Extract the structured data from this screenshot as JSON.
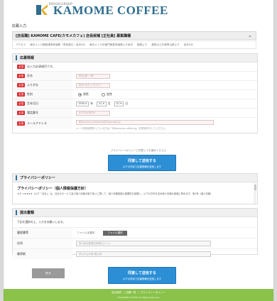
{
  "header": {
    "brand_small": "ROUGH GROUP",
    "brand": "KAMOME COFFEE"
  },
  "section_label": "応募入力",
  "job": {
    "title": "[店長職] KAMOME CAFE(カモメカフェ) 店長候補 [正社員] 募集職種",
    "sub_items": [
      "アクセス",
      "東京メトロ銀座線表参道駅「表参道口」徒歩5分",
      "東京メトロ半蔵門線表参道駅より徒歩",
      "銀座より",
      "都営大江戸線青山駅より",
      "徒歩5分"
    ]
  },
  "form": {
    "title": "応募情報",
    "req_badge": "必須",
    "req_note": "は入力必須項目です。",
    "fields": [
      {
        "label": "氏名",
        "placeholder": "例)山田 一郎"
      },
      {
        "label": "ふりがな",
        "placeholder": "例)やまだ いちろう"
      },
      {
        "label": "性別",
        "options": [
          "男性",
          "女性"
        ]
      },
      {
        "label": "生年月日",
        "year": "1990",
        "year_unit": "年",
        "month": "01",
        "month_unit": "月",
        "day": "01",
        "day_unit": "日"
      },
      {
        "label": "電話番号",
        "placeholder": "0312345678"
      },
      {
        "label": "メールアドレス",
        "placeholder": "例)xxxxxx_kamome@example.jp",
        "note": "メール受信制限をしている方は「@kamome-coffee.jp」を受信許可してください。"
      }
    ]
  },
  "consent_text": "プライバシーポリシーに同意してお進みください",
  "submit_top": {
    "line1": "同意して送信する",
    "line2": "以下の内容で応募情報を送信します"
  },
  "privacy": {
    "head": "プライバシーポリシー",
    "title": "プライバシーポリシー（個人情報保護方針）",
    "text": "カモメ★★★★（以下「当社」）は、当社のサービス及び個人情報の取り扱いに関して、個人情報保護の重要性を認識し、以下の方針を定め個人情報の保護に努めます。第1条（個人情報）"
  },
  "upload": {
    "head": "提出書類",
    "note": "下記を選択の上、入力をお願いします。",
    "rows": [
      {
        "label": "履歴書等",
        "file": "ファイル未選択",
        "button": "ファイル選択"
      },
      {
        "label": "住所",
        "placeholder": "例) 東京都港区南青山1-1-1"
      },
      {
        "label": "最寄駅",
        "placeholder": "例) JR山手線 恵比寿"
      }
    ]
  },
  "back_button": "戻る",
  "submit_bottom": {
    "line1": "同意して送信する",
    "line2": "以下の内容で応募情報を送信します"
  },
  "footer": {
    "links": [
      "会社案内",
      "店舗一覧",
      "プライバシーポリシー"
    ],
    "copyright": "©KAMOME COFFEE All Rights Reserved."
  },
  "colors": {
    "brand": "#2f6d8f",
    "accent": "#2c8fd6",
    "required": "#d9292e",
    "footer": "#8ac24a"
  }
}
